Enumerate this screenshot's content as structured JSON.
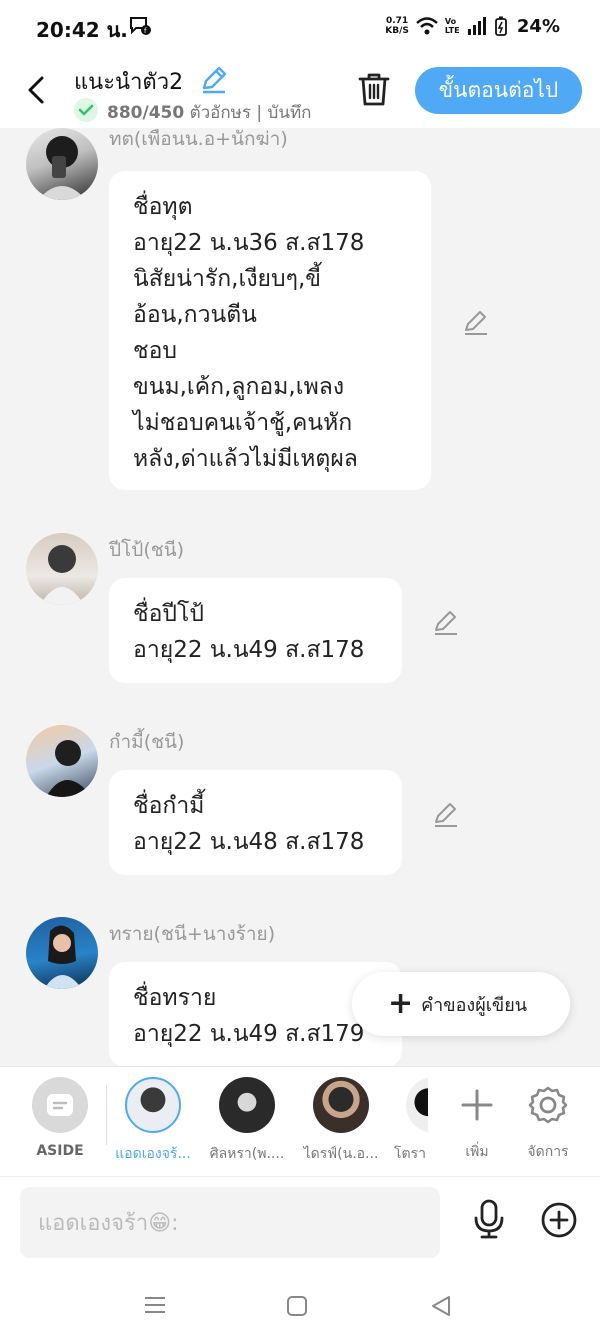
{
  "status_bar": {
    "time": "20:42 น.",
    "net_speed_value": "0.71",
    "net_speed_unit": "KB/S",
    "volte": "Vo LTE",
    "battery": "24%"
  },
  "header": {
    "title": "แนะนำตัว2",
    "char_count": "880/450",
    "subtitle_rest": " ตัวอักษร | บันทึก",
    "next_label": "ขั้นตอนต่อไป"
  },
  "messages": [
    {
      "sender": "ทต(เพื่อนน.อ+นักฆ่า)",
      "lines": [
        "ชื่อทุต",
        "อายุ22 น.น36 ส.ส178",
        "นิสัยน่ารัก,เงียบๆ,ขี้",
        "อ้อน,กวนตีน",
        "ชอบ",
        "ขนม,เค้ก,ลูกอม,เพลง",
        "ไม่ชอบคนเจ้าชู้,คนหัก",
        "หลัง,ด่าแล้วไม่มีเหตุผล"
      ]
    },
    {
      "sender": "ปีโป้(ชนี)",
      "lines": [
        "ชื่อปีโป้",
        "อายุ22 น.น49 ส.ส178"
      ]
    },
    {
      "sender": "กำมี้(ชนี)",
      "lines": [
        "ชื่อกำมี้",
        "อายุ22 น.น48 ส.ส178"
      ]
    },
    {
      "sender": "ทราย(ชนี+นางร้าย)",
      "lines": [
        "ชื่อทราย",
        "อายุ22 น.น49 ส.ส179"
      ]
    }
  ],
  "floating_note": {
    "label": "คำของผู้เขียน"
  },
  "characters": {
    "aside_label": "ASIDE",
    "items": [
      {
        "label": "แอดเองจร้..."
      },
      {
        "label": "ศิลหรา(พ...."
      },
      {
        "label": "ไดรฟ์(น.อ..."
      },
      {
        "label": "โตรา"
      }
    ],
    "add_label": "เพิ่ม",
    "manage_label": "จัดการ"
  },
  "input": {
    "placeholder": "แอดเองจร้า😁:"
  },
  "colors": {
    "accent": "#4fa9f5",
    "active_character": "#4fa9f5",
    "check": "#2ec46a"
  }
}
